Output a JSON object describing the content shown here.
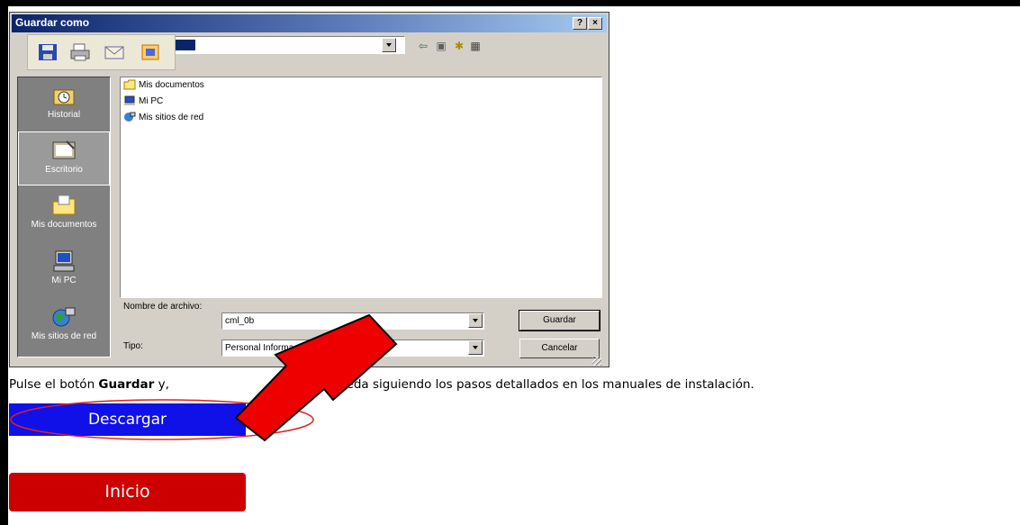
{
  "dialog": {
    "title": "Guardar como",
    "help_btn": "?",
    "close_btn": "×",
    "places": [
      {
        "label": "Historial",
        "icon": "history-icon"
      },
      {
        "label": "Escritorio",
        "icon": "desktop-icon"
      },
      {
        "label": "Mis documentos",
        "icon": "my-documents-icon"
      },
      {
        "label": "Mi PC",
        "icon": "my-computer-icon"
      },
      {
        "label": "Mis sitios de red",
        "icon": "network-places-icon"
      }
    ],
    "files": [
      {
        "name": "Mis documentos",
        "icon": "folder-icon"
      },
      {
        "name": "Mi PC",
        "icon": "computer-icon"
      },
      {
        "name": "Mis sitios de red",
        "icon": "network-icon"
      }
    ],
    "filename_label": "Nombre de archivo:",
    "filename_value": "cml_0b",
    "type_label": "Tipo:",
    "type_value": "Personal Informa",
    "save_button": "Guardar",
    "cancel_button": "Cancelar"
  },
  "page": {
    "instruction_pre": "Pulse el botón ",
    "instruction_bold": "Guardar",
    "instruction_mid": " y, ",
    "instruction_post": "ación, proceda siguiendo los pasos detallados en los manuales de instalación.",
    "download_button": "Descargar",
    "home_button": "Inicio"
  },
  "colors": {
    "download": "#1010e8",
    "home": "#cc0000",
    "arrow": "#ee0000",
    "titlebar": "#0a246a"
  }
}
